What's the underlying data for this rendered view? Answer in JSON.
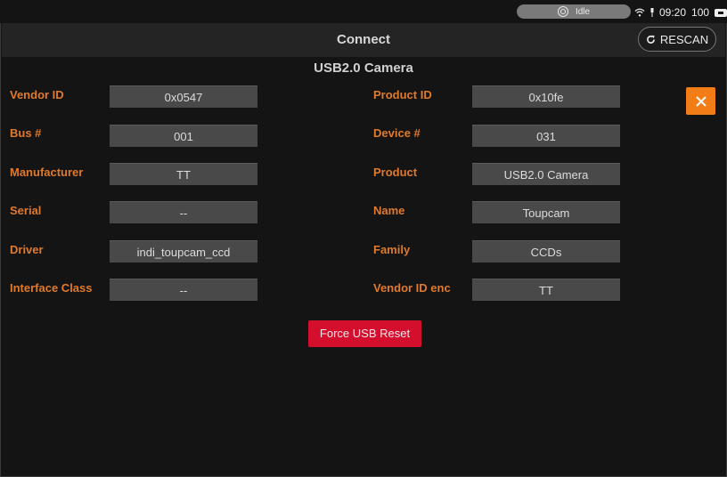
{
  "status_bar": {
    "status_text": "Idle",
    "time": "09:20",
    "battery": "100",
    "icons": [
      "target-icon",
      "wifi-icon",
      "pin-icon",
      "battery-icon"
    ]
  },
  "toolbar": {
    "title": "Connect",
    "rescan_label": "RESCAN",
    "rescan_icon": "refresh-icon"
  },
  "device": {
    "title": "USB2.0 Camera",
    "left": [
      {
        "label": "Vendor ID",
        "value": "0x0547"
      },
      {
        "label": "Bus #",
        "value": "001"
      },
      {
        "label": "Manufacturer",
        "value": "TT"
      },
      {
        "label": "Serial",
        "value": "--"
      },
      {
        "label": "Driver",
        "value": "indi_toupcam_ccd"
      },
      {
        "label": "Interface Class",
        "value": "--"
      }
    ],
    "right": [
      {
        "label": "Product ID",
        "value": "0x10fe"
      },
      {
        "label": "Device #",
        "value": "031"
      },
      {
        "label": "Product",
        "value": "USB2.0 Camera"
      },
      {
        "label": "Name",
        "value": "Toupcam"
      },
      {
        "label": "Family",
        "value": "CCDs"
      },
      {
        "label": "Vendor ID enc",
        "value": "TT"
      }
    ],
    "reset_label": "Force USB Reset"
  },
  "colors": {
    "label": "#e07a2c",
    "close_button": "#f27d17",
    "reset_button": "#d40f2e",
    "field_bg": "#494949",
    "background": "#141414"
  }
}
